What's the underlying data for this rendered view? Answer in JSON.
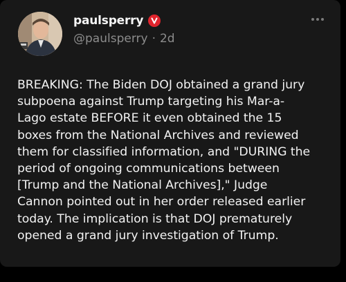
{
  "post": {
    "author": {
      "display_name": "paulsperry",
      "handle": "@paulsperry",
      "separator": "·",
      "time_ago": "2d",
      "verified_icon": "verified-badge-icon",
      "verified_color": "#e0242d"
    },
    "more_icon": "more-options-icon",
    "text_lines": [
      "BREAKING: The Biden DOJ obtained a grand jury",
      "subpoena against Trump targeting his Mar-a-",
      "Lago estate BEFORE it even obtained the 15",
      "boxes from the National Archives and reviewed",
      "them for classified information, and \"DURING the",
      "period of ongoing communications between",
      "[Trump and the National Archives],\" Judge",
      "Cannon pointed out in her order released earlier",
      "today. The implication is that DOJ prematurely",
      "opened a grand jury investigation of Trump."
    ]
  },
  "colors": {
    "background": "#000000",
    "card": "#181818",
    "text": "#f2f2f2",
    "muted": "#8c8c8c"
  }
}
